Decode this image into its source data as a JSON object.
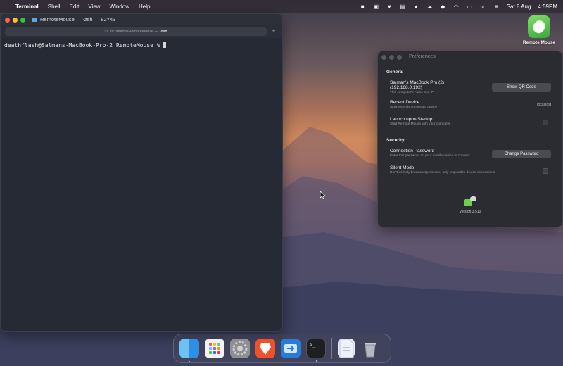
{
  "menubar": {
    "items": [
      "Terminal",
      "Shell",
      "Edit",
      "View",
      "Window",
      "Help"
    ],
    "date": "Sat 8 Aug",
    "time": "4:59PM"
  },
  "terminal": {
    "title": "RemoteMouse — -zsh — 82×43",
    "tab_path": "~/Documents/RemoteMouse — ",
    "tab_shell": "-zsh",
    "add_tab": "+",
    "prompt": "deathflash@Salmans-MacBook-Pro-2 RemoteMouse %"
  },
  "desktop_icon": {
    "label": "Remote Mouse"
  },
  "preferences": {
    "title": "Preferences",
    "general_header": "General",
    "computer_name": "Salman's MacBook Pro (2)",
    "computer_ip": "(192.168.0.192)",
    "computer_sub": "This computer's name and IP",
    "show_qr_label": "Show QR Code",
    "recent_device_label": "Recent Device",
    "recent_device_sub": "Most recently connected device",
    "recent_device_value": "localhost",
    "launch_label": "Launch upon Startup",
    "launch_sub": "Start Remote Mouse with your computer",
    "security_header": "Security",
    "password_label": "Connection Password",
    "password_sub": "Enter this password on your mobile device to connect",
    "change_password_label": "Change Password",
    "silent_label": "Silent Mode",
    "silent_sub": "Don't actively broadcast presence, only respond to device connections",
    "version": "Version 3.510"
  },
  "dock": {
    "items": [
      "finder-icon",
      "launchpad-icon",
      "system-settings-icon",
      "brave-icon",
      "migration-assistant-icon",
      "terminal-icon",
      "document-icon",
      "trash-icon"
    ],
    "terminal_glyph": ">_"
  }
}
